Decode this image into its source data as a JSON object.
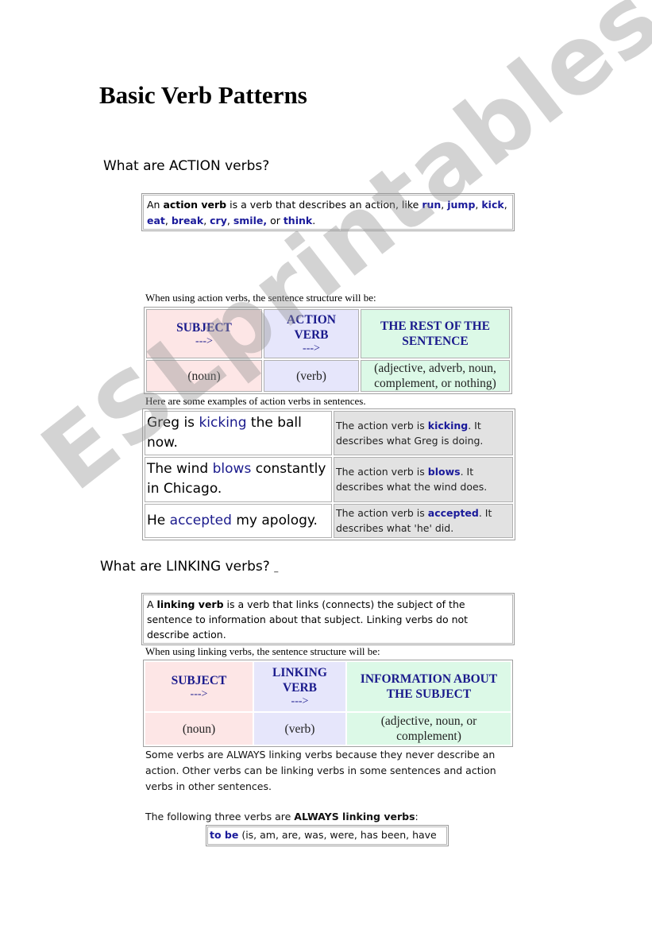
{
  "title": "Basic Verb Patterns",
  "action_section": {
    "heading": "What are ACTION verbs?",
    "definition": {
      "prefix": "An ",
      "term": "action verb",
      "middle": " is a verb that describes an action, like ",
      "examples": [
        "run",
        "jump",
        "kick",
        "eat",
        "break",
        "cry",
        "smile"
      ],
      "sep": ", ",
      "or_text": " or ",
      "last_example": "think",
      "end": "."
    },
    "structure_intro": "When using action verbs, the sentence structure will be:",
    "structure_table": {
      "headers": [
        {
          "label": "SUBJECT",
          "arrow": "--->"
        },
        {
          "label": "ACTION VERB",
          "arrow": "--->"
        },
        {
          "label": "THE REST OF THE SENTENCE",
          "arrow": ""
        }
      ],
      "values": [
        "(noun)",
        "(verb)",
        "(adjective, adverb, noun, complement, or nothing)"
      ]
    },
    "examples_intro": "Here are some examples of action verbs in sentences.",
    "examples": [
      {
        "before": "Greg is ",
        "verb": "kicking",
        "after": " the ball now.",
        "expl_prefix": "The action verb is ",
        "expl_verb": "kicking",
        "expl_suffix": ".  It describes what Greg is doing."
      },
      {
        "before": "The wind ",
        "verb": "blows",
        "after": " constantly in Chicago.",
        "expl_prefix": "The action verb is ",
        "expl_verb": "blows",
        "expl_suffix": ".  It describes what the wind does."
      },
      {
        "before": "He ",
        "verb": "accepted",
        "after": " my apology.",
        "expl_prefix": "The action verb is ",
        "expl_verb": "accepted",
        "expl_suffix": ".  It describes what 'he' did."
      }
    ]
  },
  "linking_section": {
    "heading": "What are LINKING verbs?",
    "heading_suffix": "_",
    "definition": {
      "prefix": "A ",
      "term": "linking verb",
      "rest": " is a verb that links (connects) the subject of the sentence to information about that subject.   Linking verbs do not describe action."
    },
    "structure_intro": "When using linking verbs, the sentence structure will be:",
    "structure_table": {
      "headers": [
        {
          "label": "SUBJECT",
          "arrow": "--->"
        },
        {
          "label": "LINKING VERB",
          "arrow": "--->"
        },
        {
          "label": "INFORMATION ABOUT THE SUBJECT",
          "arrow": ""
        }
      ],
      "values": [
        "(noun)",
        "(verb)",
        "(adjective, noun, or complement)"
      ]
    },
    "always_paragraph": "Some verbs are ALWAYS linking verbs because they never describe an action.  Other verbs can be linking verbs in some sentences and action verbs in other sentences.",
    "following": {
      "prefix": "The following three verbs are ",
      "bold": "ALWAYS linking verbs",
      "suffix": ":"
    },
    "to_be": {
      "term": "to be",
      "forms": " (is, am, are, was, were, has been, have"
    }
  },
  "watermark": "ESLprintables.com",
  "colors": {
    "accent_blue": "#1a1a8c",
    "subject_cell": "#fde6e6",
    "verb_cell": "#e6e6fb",
    "rest_cell": "#dcf9e7",
    "explanation_cell": "#e2e2e2"
  }
}
